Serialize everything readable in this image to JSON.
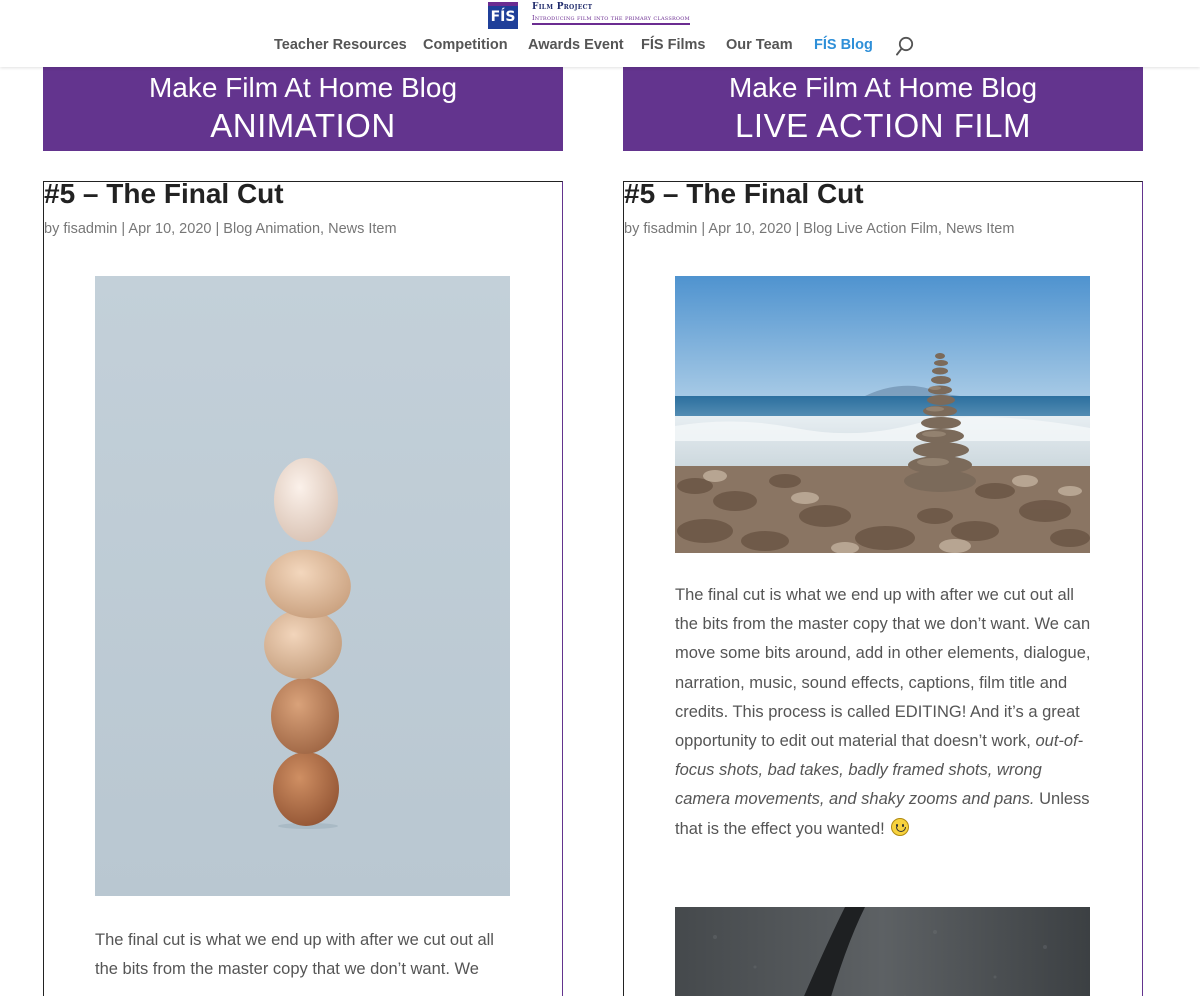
{
  "header": {
    "logo_mark": "FÍS",
    "logo_title": "Film Project",
    "logo_tagline": "Introducing film into the primary classroom",
    "nav": [
      {
        "label": "Teacher Resources",
        "active": false
      },
      {
        "label": "Competition",
        "active": false
      },
      {
        "label": "Awards Event",
        "active": false
      },
      {
        "label": "FÍS Films",
        "active": false
      },
      {
        "label": "Our Team",
        "active": false
      },
      {
        "label": "FÍS Blog",
        "active": true
      }
    ],
    "search_icon": "search-icon",
    "accent_color": "#2e8fd8"
  },
  "columns": [
    {
      "banner_line1": "Make Film At Home Blog",
      "banner_line2": "ANIMATION",
      "post": {
        "title": "#5 – The Final Cut",
        "by": "by",
        "author": "fisadmin",
        "sep": "|",
        "date": "Apr 10, 2020",
        "category1": "Blog Animation",
        "category2": "News Item",
        "image": "stacked-eggs-photo",
        "text_line1": "The final cut is what we end up with after we cut out all",
        "text_line2": "the bits from the master copy that we don’t want.  We"
      }
    },
    {
      "banner_line1": "Make Film At Home Blog",
      "banner_line2": "LIVE ACTION FILM",
      "post": {
        "title": "#5 – The Final Cut",
        "by": "by",
        "author": "fisadmin",
        "sep": "|",
        "date": "Apr 10, 2020",
        "category1": "Blog Live Action Film",
        "category2": "News Item",
        "image": "stacked-stones-beach-photo",
        "para_part1": "The final cut is what we end up with after we cut out all the bits from the master copy that we don’t want.  We can move some bits around, add in other elements, dialogue, narration, music, sound effects, captions, film title and credits.  This process is called EDITING!  And it’s a great opportunity to edit out material that doesn’t work,",
        "para_italic": "out-of-focus shots, bad takes, badly framed shots, wrong camera movements, and shaky zooms and pans.",
        "para_part2": " Unless that is the effect you wanted!",
        "emoji": "smiley-icon",
        "second_image": "dark-texture-photo"
      }
    }
  ],
  "colors": {
    "banner": "#63348e",
    "text": "#555555"
  }
}
